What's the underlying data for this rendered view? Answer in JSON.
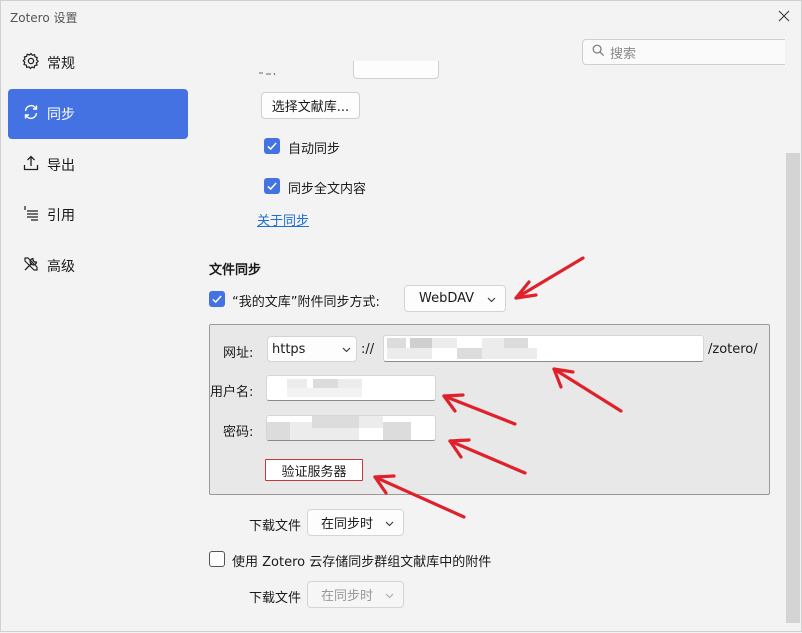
{
  "window": {
    "title": "Zotero 设置"
  },
  "search": {
    "placeholder": "搜索"
  },
  "sidebar": {
    "items": [
      {
        "label": "常规",
        "icon": "gear-icon",
        "active": false
      },
      {
        "label": "同步",
        "icon": "sync-icon",
        "active": true
      },
      {
        "label": "导出",
        "icon": "export-icon",
        "active": false
      },
      {
        "label": "引用",
        "icon": "cite-icon",
        "active": false
      },
      {
        "label": "高级",
        "icon": "tools-icon",
        "active": false
      }
    ]
  },
  "data_sync": {
    "choose_library_label": "选择文献库...",
    "auto_sync_label": "自动同步",
    "auto_sync_checked": true,
    "fulltext_sync_label": "同步全文内容",
    "fulltext_sync_checked": true,
    "about_sync_link": "关于同步"
  },
  "file_sync": {
    "section_title": "文件同步",
    "my_library_label": "“我的文库”附件同步方式:",
    "my_library_checked": true,
    "method_value": "WebDAV",
    "url_label": "网址:",
    "protocol_value": "https",
    "protocol_sep": "://",
    "url_suffix": "/zotero/",
    "username_label": "用户名:",
    "password_label": "密码:",
    "verify_button": "验证服务器",
    "download_files_label": "下载文件",
    "download_files_value": "在同步时",
    "group_sync_label": "使用 Zotero 云存储同步群组文献库中的附件",
    "group_sync_checked": false,
    "group_download_label": "下载文件",
    "group_download_value": "在同步时"
  },
  "colors": {
    "accent": "#4472e3",
    "link": "#1e6fd0",
    "annotation_arrow": "#e0202a",
    "verify_border": "#c0393b"
  }
}
